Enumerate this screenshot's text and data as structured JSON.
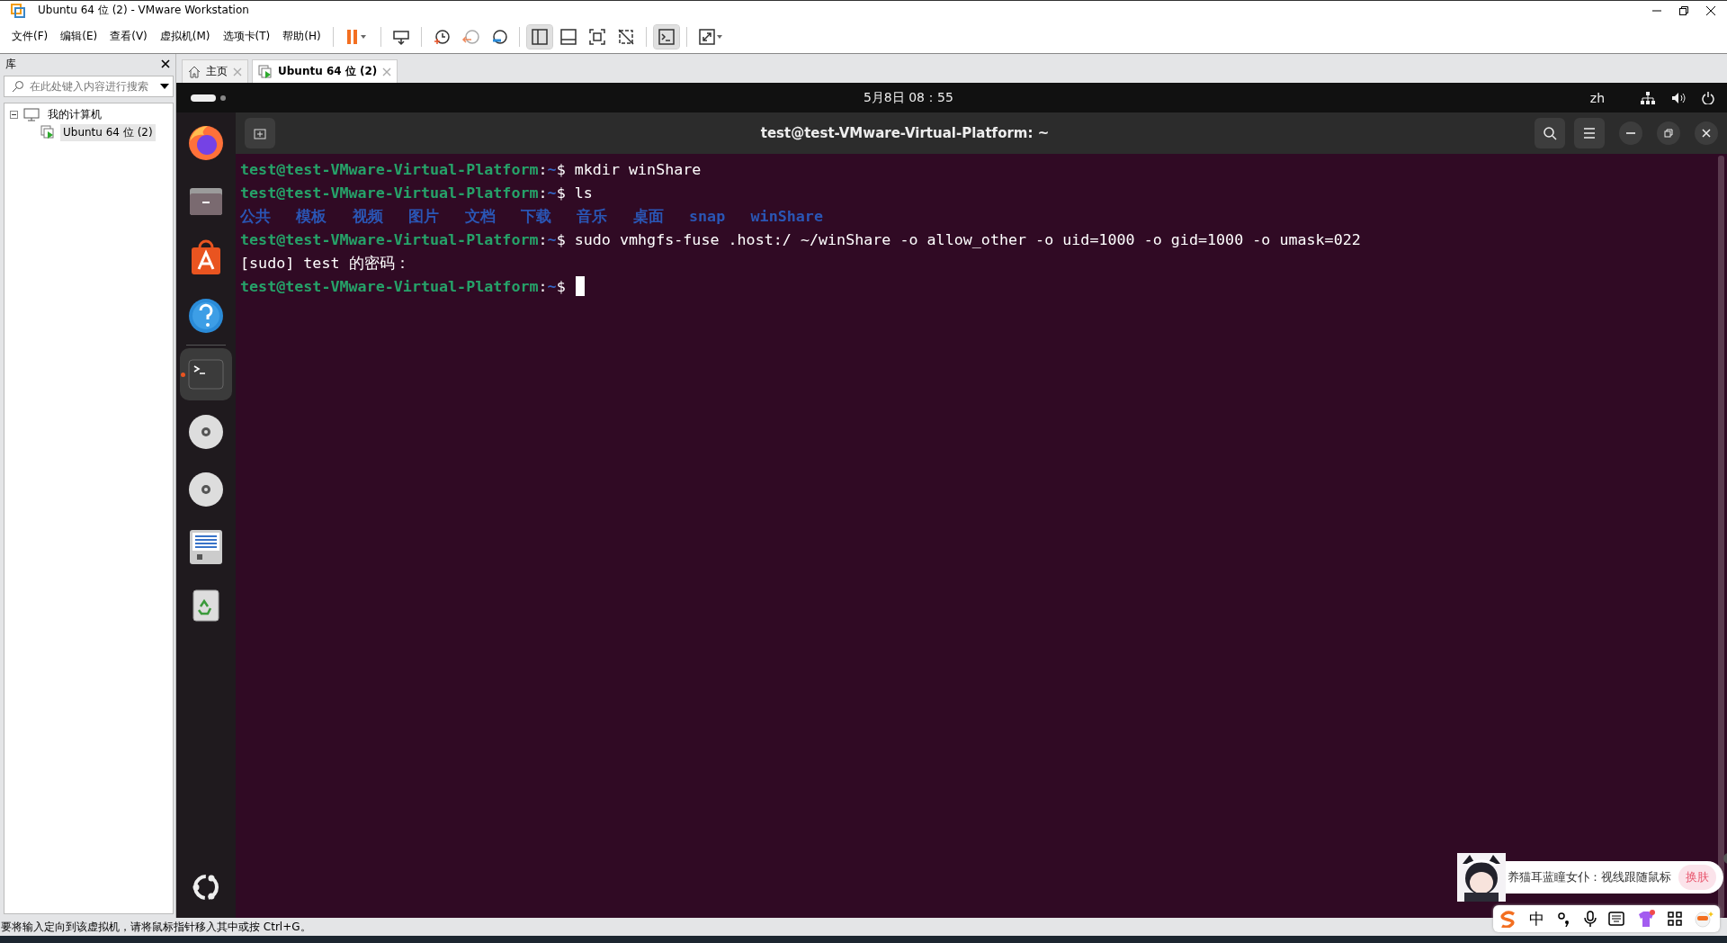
{
  "window": {
    "title": "Ubuntu 64 位 (2) - VMware Workstation"
  },
  "menu": [
    "文件(F)",
    "编辑(E)",
    "查看(V)",
    "虚拟机(M)",
    "选项卡(T)",
    "帮助(H)"
  ],
  "toolbar": [
    {
      "kind": "pause",
      "pressed": false
    },
    {
      "kind": "send-keys",
      "pressed": false
    },
    {
      "kind": "snapshot",
      "pressed": false
    },
    {
      "kind": "revert",
      "pressed": false
    },
    {
      "kind": "manage",
      "pressed": false
    },
    {
      "kind": "library",
      "pressed": true
    },
    {
      "kind": "thumbs",
      "pressed": false
    },
    {
      "kind": "fullscreen",
      "pressed": false
    },
    {
      "kind": "unity",
      "pressed": false
    },
    {
      "kind": "console",
      "pressed": true
    },
    {
      "kind": "stretch",
      "pressed": false
    }
  ],
  "library": {
    "title": "库",
    "search": {
      "placeholder": "在此处键入内容进行搜索"
    },
    "tree": [
      {
        "label": "我的计算机",
        "expanded": true,
        "selected": false,
        "children": [
          {
            "label": "Ubuntu 64 位 (2)",
            "selected": true
          }
        ]
      }
    ]
  },
  "tabs": [
    {
      "label": "主页",
      "kind": "home",
      "selected": false
    },
    {
      "label": "Ubuntu 64 位 (2)",
      "kind": "vm",
      "selected": true
    }
  ],
  "ubuntu_topbar": {
    "clock": "5月8日  08：55",
    "language": "zh"
  },
  "dock": [
    {
      "kind": "firefox",
      "running": false
    },
    {
      "kind": "files",
      "running": false
    },
    {
      "kind": "software",
      "running": false
    },
    {
      "kind": "help",
      "running": false
    },
    {
      "kind": "terminal",
      "running": true
    },
    {
      "kind": "disc",
      "running": false
    },
    {
      "kind": "disc",
      "running": false
    },
    {
      "kind": "document",
      "running": false
    },
    {
      "kind": "trash",
      "running": false
    }
  ],
  "terminal": {
    "title": "test@test-VMware-Virtual-Platform: ~",
    "lines": [
      {
        "kind": "prompt",
        "user": "test@test-VMware-Virtual-Platform",
        "separator": ":",
        "path": "~",
        "symbol": "$",
        "command": "mkdir winShare",
        "cursor": false
      },
      {
        "kind": "prompt",
        "user": "test@test-VMware-Virtual-Platform",
        "separator": ":",
        "path": "~",
        "symbol": "$",
        "command": "ls",
        "cursor": false
      },
      {
        "kind": "listing",
        "items": [
          "公共",
          "模板",
          "视频",
          "图片",
          "文档",
          "下载",
          "音乐",
          "桌面",
          "snap",
          "winShare"
        ]
      },
      {
        "kind": "prompt",
        "user": "test@test-VMware-Virtual-Platform",
        "separator": ":",
        "path": "~",
        "symbol": "$",
        "command": "sudo vmhgfs-fuse .host:/ ~/winShare -o allow_other -o uid=1000 -o gid=1000 -o umask=022",
        "cursor": false
      },
      {
        "kind": "text",
        "text": "[sudo] test 的密码："
      },
      {
        "kind": "prompt",
        "user": "test@test-VMware-Virtual-Platform",
        "separator": ":",
        "path": "~",
        "symbol": "$",
        "cursor": true
      }
    ]
  },
  "ime_popup": {
    "message": "养猫耳蓝瞳女仆：视线跟随鼠标",
    "button": "换肤"
  },
  "ime_toolbar": {
    "mode": "中"
  },
  "status_bar": "要将输入定向到该虚拟机，请将鼠标指针移入其中或按 Ctrl+G。"
}
